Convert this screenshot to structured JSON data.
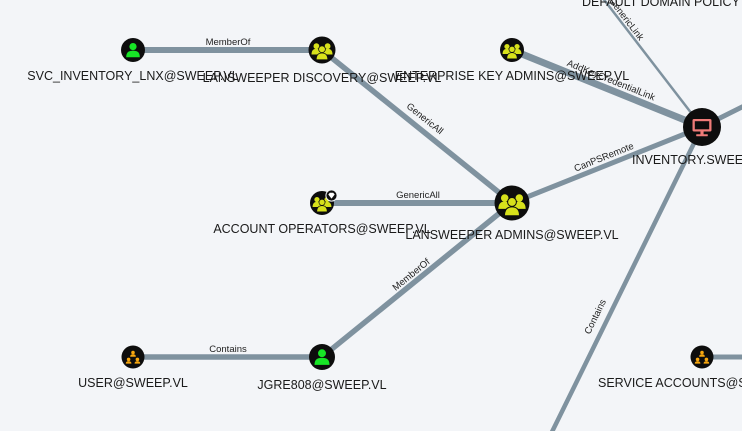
{
  "colors": {
    "background": "#f3f5f8",
    "edge": "#7f929f",
    "group": "#d7e11b",
    "user": "#17e626",
    "ou": "#f7a70f",
    "computer": "#ef7b78",
    "node_border": "#0d0d0d",
    "label_text": "#1a1a1a"
  },
  "nodes": {
    "svc_inventory": {
      "label": "SVC_INVENTORY_LNX@SWEEP.VL",
      "icon": "user-icon"
    },
    "lansweeper_discovery": {
      "label": "LANSWEEPER DISCOVERY@SWEEP.VL",
      "icon": "group-icon"
    },
    "enterprise_key_admins": {
      "label": "ENTERPRISE KEY ADMINS@SWEEP.VL",
      "icon": "group-icon"
    },
    "default_domain_policy": {
      "label": "DEFAULT DOMAIN POLICY",
      "icon": "gpo-icon"
    },
    "inventory": {
      "label": "INVENTORY.SWEEP.VL",
      "icon": "computer-icon"
    },
    "account_operators": {
      "label": "ACCOUNT OPERATORS@SWEEP.VL",
      "icon": "group-icon",
      "badge": "tier-zero-icon"
    },
    "lansweeper_admins": {
      "label": "LANSWEEPER ADMINS@SWEEP.VL",
      "icon": "group-icon"
    },
    "user_ou": {
      "label": "USER@SWEEP.VL",
      "icon": "ou-icon"
    },
    "jgre808": {
      "label": "JGRE808@SWEEP.VL",
      "icon": "user-icon"
    },
    "service_accounts": {
      "label": "SERVICE ACCOUNTS@SWEEP.VL",
      "icon": "ou-icon"
    }
  },
  "edges": {
    "svc_memberof": "MemberOf",
    "discovery_genericall": "GenericAll",
    "eka_addkeycredentiallink": "AddKeyCredentialLink",
    "gpo_genericlink": "GenericLink",
    "admins_canpsremote": "CanPSRemote",
    "accops_genericall": "GenericAll",
    "jgre_memberof": "MemberOf",
    "user_contains": "Contains",
    "inventory_contains": "Contains"
  }
}
